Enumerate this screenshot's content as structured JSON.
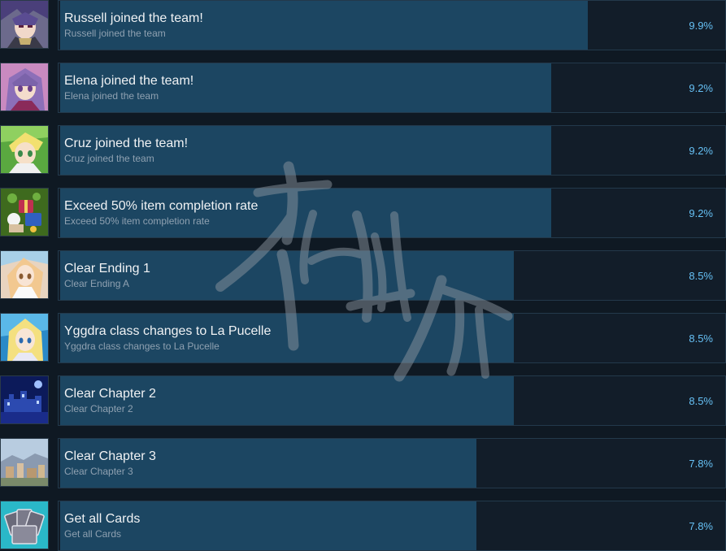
{
  "achievements": [
    {
      "title": "Russell joined the team!",
      "description": "Russell joined the team",
      "percent": "9.9%",
      "icon": "russell-portrait-icon",
      "bar": 0.099
    },
    {
      "title": "Elena joined the team!",
      "description": "Elena joined the team",
      "percent": "9.2%",
      "icon": "elena-portrait-icon",
      "bar": 0.092
    },
    {
      "title": "Cruz joined the team!",
      "description": "Cruz joined the team",
      "percent": "9.2%",
      "icon": "cruz-portrait-icon",
      "bar": 0.092
    },
    {
      "title": "Exceed 50% item completion rate",
      "description": "Exceed 50% item completion rate",
      "percent": "9.2%",
      "icon": "item-pile-icon",
      "bar": 0.092
    },
    {
      "title": "Clear Ending 1",
      "description": "Clear Ending A",
      "percent": "8.5%",
      "icon": "ending-portrait-icon",
      "bar": 0.085
    },
    {
      "title": "Yggdra class changes to La Pucelle",
      "description": "Yggdra class changes to La Pucelle",
      "percent": "8.5%",
      "icon": "yggdra-portrait-icon",
      "bar": 0.085
    },
    {
      "title": "Clear Chapter 2",
      "description": "Clear Chapter 2",
      "percent": "8.5%",
      "icon": "castle-night-icon",
      "bar": 0.085
    },
    {
      "title": "Clear Chapter 3",
      "description": "Clear Chapter 3",
      "percent": "7.8%",
      "icon": "town-view-icon",
      "bar": 0.078
    },
    {
      "title": "Get all Cards",
      "description": "Get all Cards",
      "percent": "7.8%",
      "icon": "cards-icon",
      "bar": 0.078
    }
  ],
  "colors": {
    "bar": "#1c4662",
    "percent": "#66c0f4",
    "title": "#f0f2f4",
    "description": "#8fa1b1",
    "background": "#0f1923"
  }
}
